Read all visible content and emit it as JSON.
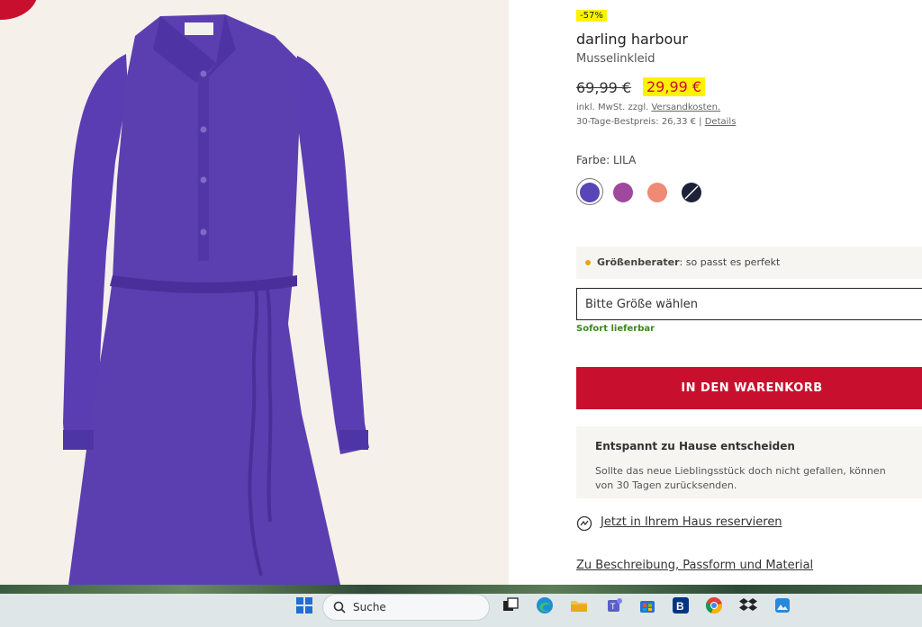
{
  "product": {
    "discount_badge": "-57%",
    "brand": "darling harbour",
    "name": "Musselinkleid",
    "old_price": "69,99 €",
    "new_price": "29,99 €",
    "vat_prefix": "inkl. MwSt. zzgl.",
    "vat_link": "Versandkosten.",
    "best_price_text": "30-Tage-Bestpreis: 26,33 € |",
    "best_price_link": "Details",
    "color_label": "Farbe: LILA",
    "colors": [
      {
        "name": "lila",
        "hex": "#5a45b8"
      },
      {
        "name": "violett",
        "hex": "#a0479e"
      },
      {
        "name": "lachs",
        "hex": "#ef8a74"
      },
      {
        "name": "navy",
        "hex": "#1e2238"
      }
    ]
  },
  "size_advisor": {
    "label": "Größenberater",
    "text": ": so passt es perfekt"
  },
  "size_select": {
    "placeholder": "Bitte Größe wählen",
    "availability": "Sofort lieferbar"
  },
  "cart_button": "IN DEN WARENKORB",
  "info": {
    "heading": "Entspannt zu Hause entscheiden",
    "text_line1": "Sollte das neue Lieblingsstück doch nicht gefallen, können",
    "text_line2": "von 30 Tagen zurücksenden."
  },
  "reserve_link": "Jetzt in Ihrem Haus reservieren",
  "description_link": "Zu Beschreibung, Passform und Material",
  "taskbar": {
    "search_label": "Suche",
    "icons": [
      "windows-start-icon",
      "search-icon",
      "task-view-icon",
      "edge-icon",
      "file-explorer-icon",
      "teams-icon",
      "store-icon",
      "booking-icon",
      "chrome-icon",
      "dropbox-icon",
      "photos-icon"
    ]
  },
  "colors": {
    "accent_red": "#c8102e",
    "highlight_yellow": "#fff200",
    "available_green": "#3a8a1b",
    "dress_purple": "#5b3fb0"
  }
}
